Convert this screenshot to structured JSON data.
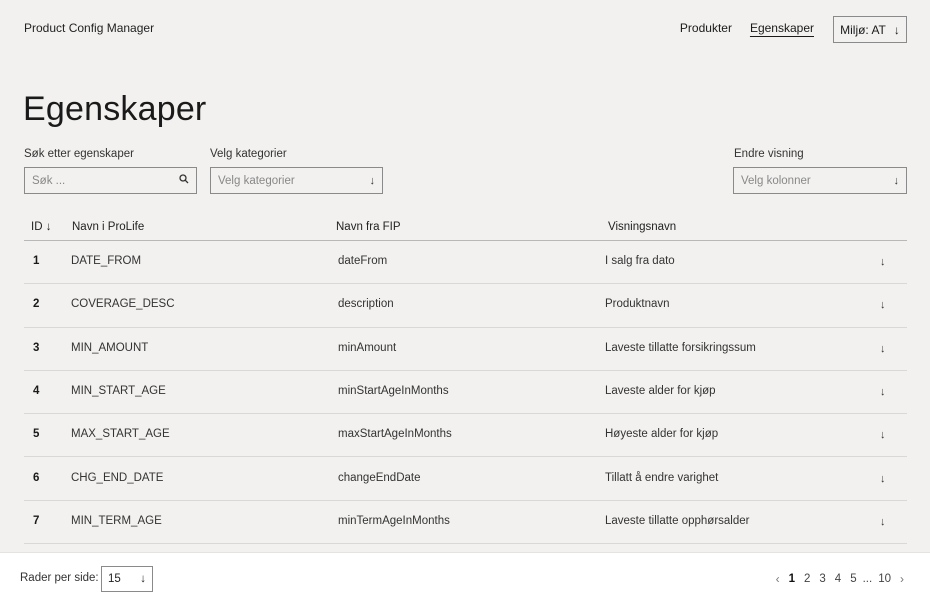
{
  "header": {
    "brand": "Product Config Manager",
    "nav": [
      "Produkter",
      "Egenskaper"
    ],
    "env_label": "Miljø: AT",
    "env_icon": "↓"
  },
  "page": {
    "title": "Egenskaper"
  },
  "filters": {
    "search_label": "Søk etter egenskaper",
    "search_placeholder": "Søk ...",
    "category_label": "Velg kategorier",
    "category_placeholder": "Velg kategorier",
    "view_label": "Endre visning",
    "view_placeholder": "Velg kolonner"
  },
  "table": {
    "headers": {
      "id": "ID ↓",
      "prolife": "Navn i ProLife",
      "fip": "Navn fra FIP",
      "display": "Visningsnavn"
    },
    "rows": [
      {
        "id": "1",
        "prolife": "DATE_FROM",
        "fip": "dateFrom",
        "display": "I salg fra dato"
      },
      {
        "id": "2",
        "prolife": "COVERAGE_DESC",
        "fip": "description",
        "display": "Produktnavn"
      },
      {
        "id": "3",
        "prolife": "MIN_AMOUNT",
        "fip": "minAmount",
        "display": "Laveste tillatte forsikringssum"
      },
      {
        "id": "4",
        "prolife": "MIN_START_AGE",
        "fip": "minStartAgeInMonths",
        "display": "Laveste alder for kjøp"
      },
      {
        "id": "5",
        "prolife": "MAX_START_AGE",
        "fip": "maxStartAgeInMonths",
        "display": "Høyeste alder for kjøp"
      },
      {
        "id": "6",
        "prolife": "CHG_END_DATE",
        "fip": "changeEndDate",
        "display": "Tillatt å endre varighet"
      },
      {
        "id": "7",
        "prolife": "MIN_TERM_AGE",
        "fip": "minTermAgeInMonths",
        "display": "Laveste tillatte opphørsalder"
      }
    ]
  },
  "footer": {
    "rows_per_page_label": "Rader per side:",
    "rows_per_page_value": "15",
    "pages": [
      "1",
      "2",
      "3",
      "4",
      "5",
      "...",
      "10"
    ],
    "current_page": "1",
    "prev": "‹",
    "next": "›"
  }
}
